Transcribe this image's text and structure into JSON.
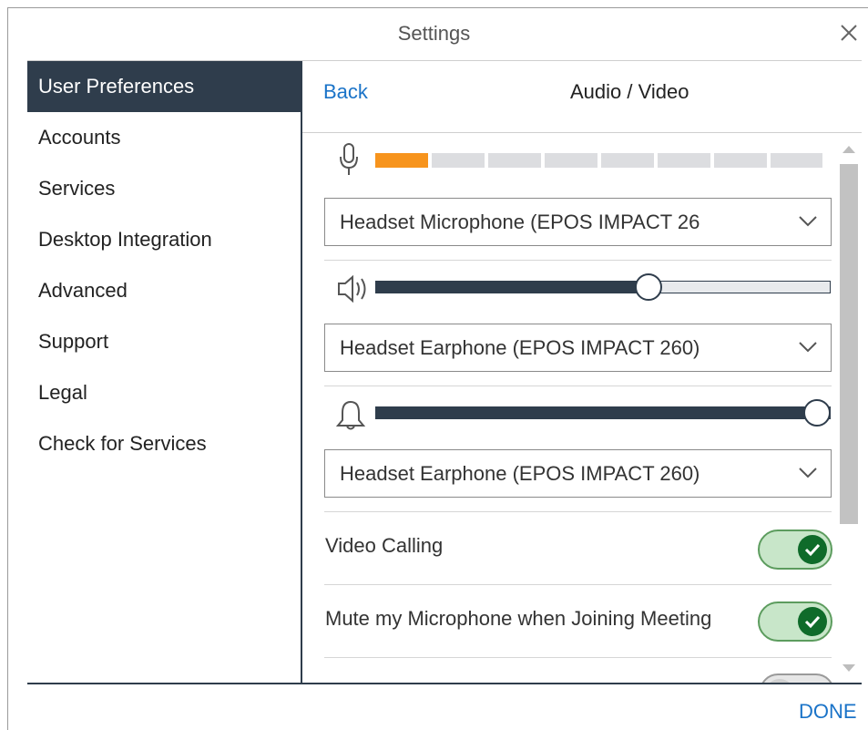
{
  "window": {
    "title": "Settings"
  },
  "sidebar": {
    "items": [
      {
        "label": "User Preferences",
        "active": true
      },
      {
        "label": "Accounts"
      },
      {
        "label": "Services"
      },
      {
        "label": "Desktop Integration"
      },
      {
        "label": "Advanced"
      },
      {
        "label": "Support"
      },
      {
        "label": "Legal"
      },
      {
        "label": "Check for Services"
      }
    ]
  },
  "header": {
    "back_label": "Back",
    "title": "Audio / Video"
  },
  "audio": {
    "mic_level": {
      "icon": "microphone-icon",
      "active_segments": 1,
      "total_segments": 8,
      "accent": "#f7941d"
    },
    "microphone_device": "Headset Microphone (EPOS IMPACT 26",
    "speaker_volume": {
      "icon": "speaker-icon",
      "percent": 60
    },
    "speaker_device": "Headset Earphone (EPOS IMPACT 260)",
    "ringer_volume": {
      "icon": "bell-icon",
      "percent": 97
    },
    "ringer_device": "Headset Earphone (EPOS IMPACT 260)"
  },
  "toggles": [
    {
      "label": "Video Calling",
      "on": true
    },
    {
      "label": "Mute my Microphone when Joining Meeting",
      "on": true
    }
  ],
  "footer": {
    "done_label": "DONE"
  },
  "colors": {
    "primary": "#2f3d4c",
    "link": "#1a73c8",
    "toggle_on": "#0f6b2a"
  }
}
